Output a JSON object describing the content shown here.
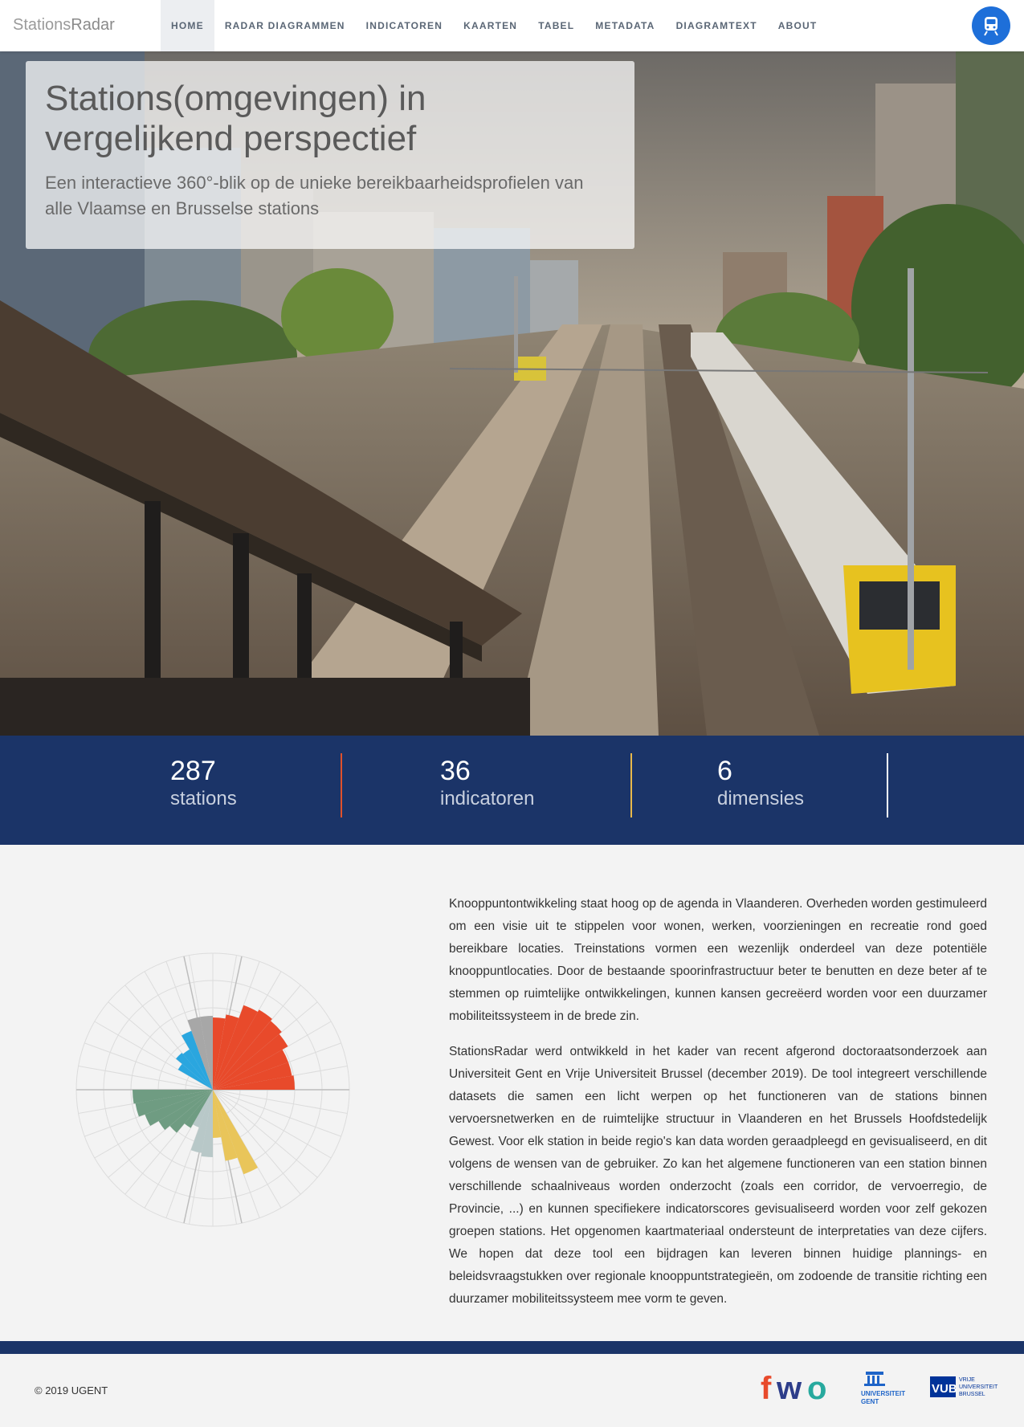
{
  "brand": {
    "part1": "Stations",
    "part2": "Radar"
  },
  "nav": {
    "items": [
      "HOME",
      "RADAR DIAGRAMMEN",
      "INDICATOREN",
      "KAARTEN",
      "TABEL",
      "METADATA",
      "DIAGRAMTEXT",
      "ABOUT"
    ],
    "active": "HOME",
    "train_icon": "train-icon"
  },
  "hero": {
    "title": "Stations(omgevingen) in vergelijkend perspectief",
    "subtitle": "Een interactieve 360°-blik op de unieke bereikbaarheidsprofielen van alle Vlaamse en Brusselse stations"
  },
  "stats": [
    {
      "value": "287",
      "label": "stations",
      "divider_color": "#e0512b"
    },
    {
      "value": "36",
      "label": "indicatoren",
      "divider_color": "#e8b84a"
    },
    {
      "value": "6",
      "label": "dimensies",
      "divider_color": "#ffffff"
    }
  ],
  "radar_colors": [
    "#e84a2b",
    "#e9c55a",
    "#b8c8c8",
    "#6f9c82",
    "#2aa6df",
    "#a7a7a7"
  ],
  "content": {
    "paragraph1": "Knooppuntontwikkeling staat hoog op de agenda in Vlaanderen. Overheden worden gestimuleerd om een visie uit te stippelen voor wonen, werken, voorzieningen en recreatie rond goed bereikbare locaties. Treinstations vormen een wezenlijk onderdeel van deze potentiële knooppuntlocaties. Door de bestaande spoorinfrastructuur beter te benutten en deze beter af te stemmen op ruimtelijke ontwikkelingen, kunnen kansen gecreëerd worden voor een duurzamer mobiliteitssysteem in de brede zin.",
    "paragraph2": "StationsRadar werd ontwikkeld in het kader van recent afgerond doctoraatsonderzoek aan Universiteit Gent en Vrije Universiteit Brussel (december 2019). De tool integreert verschillende datasets die samen een licht werpen op het functioneren van de stations binnen vervoersnetwerken en de ruimtelijke structuur in Vlaanderen en het Brussels Hoofdstedelijk Gewest. Voor elk station in beide regio's kan data worden geraadpleegd en gevisualiseerd, en dit volgens de wensen van de gebruiker. Zo kan het algemene functioneren van een station binnen verschillende schaalniveaus worden onderzocht (zoals een corridor, de vervoerregio, de Provincie, ...) en kunnen specifiekere indicatorscores gevisualiseerd worden voor zelf gekozen groepen stations. Het opgenomen kaartmateriaal ondersteunt de interpretaties van deze cijfers. We hopen dat deze tool een bijdragen kan leveren binnen huidige plannings- en beleidsvraagstukken over regionale knooppuntstrategieën, om zodoende de transitie richting een duurzamer mobiliteitssysteem mee vorm te geven."
  },
  "footer": {
    "copyright": "© 2019 UGENT",
    "logos": {
      "fwo": "fwo",
      "ugent_line1": "UNIVERSITEIT",
      "ugent_line2": "GENT",
      "vub_mark": "VUB",
      "vub_line1": "VRIJE",
      "vub_line2": "UNIVERSITEIT",
      "vub_line3": "BRUSSEL"
    }
  }
}
